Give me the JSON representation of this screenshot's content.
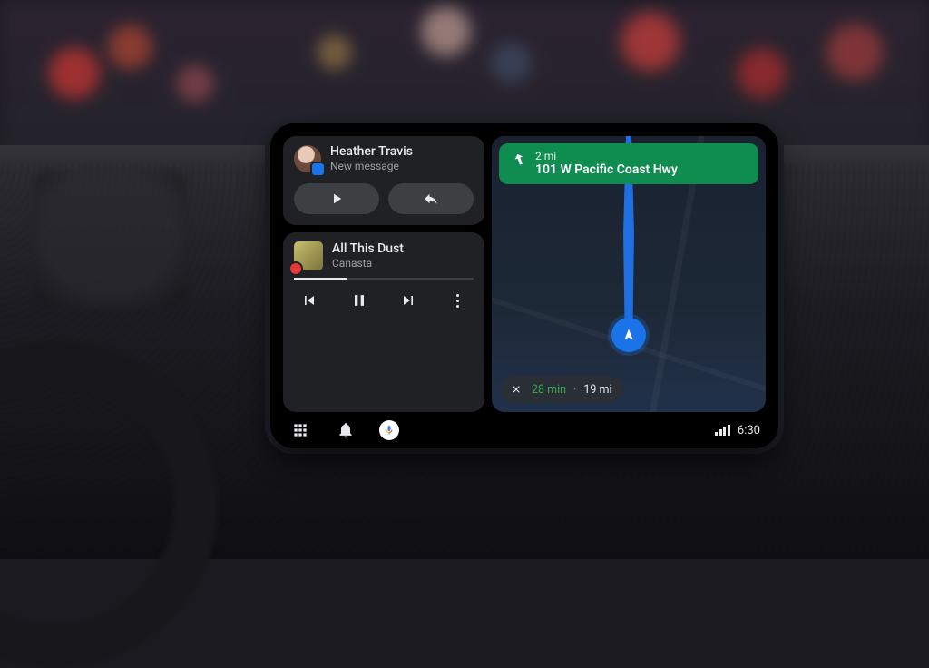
{
  "message": {
    "sender_name": "Heather Travis",
    "subtitle": "New message"
  },
  "music": {
    "track_title": "All This Dust",
    "artist": "Canasta",
    "progress_pct": 30
  },
  "navigation": {
    "maneuver_distance": "2 mi",
    "road_name": "101 W Pacific Coast Hwy",
    "eta_duration": "28 min",
    "eta_distance": "19 mi"
  },
  "status": {
    "clock": "6:30"
  },
  "colors": {
    "nav_green": "#0f8c4f",
    "route_blue": "#1a73e8",
    "eta_green": "#34a853"
  }
}
